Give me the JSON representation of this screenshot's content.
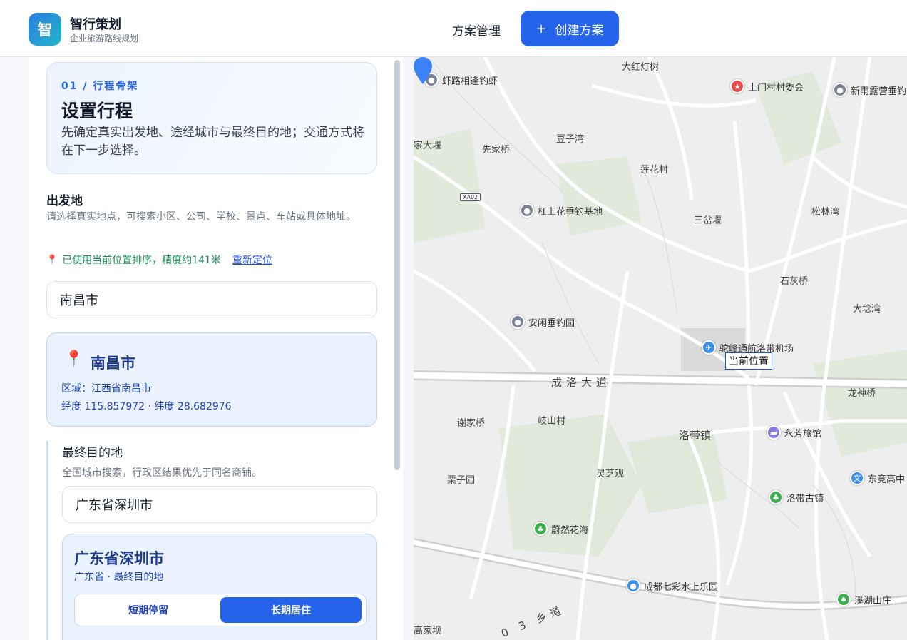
{
  "header": {
    "logo_char": "智",
    "app_name": "智行策划",
    "app_subtitle": "企业旅游路线规划",
    "nav_manage": "方案管理",
    "create_plus": "+",
    "create_label": "创建方案",
    "brand_color": "#2563eb"
  },
  "itinerary": {
    "step": "01 / 行程骨架",
    "title": "设置行程",
    "description": "先确定真实出发地、途经城市与最终目的地；交通方式将在下一步选择。"
  },
  "departure": {
    "title": "出发地",
    "description": "请选择真实地点，可搜索小区、公司、学校、景点、车站或具体地址。",
    "location_status": "已使用当前位置排序，精度约141米",
    "relocate_label": "重新定位",
    "input_value": "南昌市",
    "card": {
      "name": "南昌市",
      "region": "区域：江西省南昌市",
      "coords": "经度 115.857972 · 纬度 28.682976"
    }
  },
  "destination": {
    "title": "最终目的地",
    "description": "全国城市搜索，行政区结果优先于同名商铺。",
    "input_value": "广东省深圳市",
    "card": {
      "name": "广东省深圳市",
      "sub": "广东省 · 最终目的地",
      "option_short": "短期停留",
      "option_long": "长期居住",
      "selected": "长期居住"
    }
  },
  "map": {
    "current_position": "当前位置",
    "road_shield": "XA02",
    "roads": {
      "chengluo": "成洛大道",
      "xiang": "0 3 乡道"
    },
    "pois": [
      {
        "name": "虾路相逢钓虾",
        "icon": "poi-icon"
      },
      {
        "name": "土门村村委会",
        "icon": "government-icon"
      },
      {
        "name": "新雨露营垂钓",
        "icon": "poi-icon"
      },
      {
        "name": "杠上花垂钓基地",
        "icon": "poi-icon"
      },
      {
        "name": "安闲垂钓园",
        "icon": "poi-icon"
      },
      {
        "name": "驼峰通航洛带机场",
        "icon": "airport-icon"
      },
      {
        "name": "永芳旅馆",
        "icon": "hotel-icon"
      },
      {
        "name": "东竞高中",
        "icon": "school-icon"
      },
      {
        "name": "洛带古镇",
        "icon": "scenic-icon"
      },
      {
        "name": "蔚然花海",
        "icon": "scenic-icon"
      },
      {
        "name": "成都七彩水上乐园",
        "icon": "park-icon"
      },
      {
        "name": "溪湖山庄",
        "icon": "resort-icon"
      }
    ],
    "places": {
      "dahongdengshu": "大红灯树",
      "doizi": "豆子湾",
      "jiadayan": "家大堰",
      "xianjiaqiao": "先家桥",
      "lianhuacun": "莲花村",
      "sanchayan": "三岔堰",
      "songlinwan": "松林湾",
      "shihuiqiao": "石灰桥",
      "dalunwan": "大埝湾",
      "longshenqiao": "龙神桥",
      "xiejiaqiao": "谢家桥",
      "qishancun": "岐山村",
      "luodaizhen": "洛带镇",
      "liziyuan": "栗子园",
      "lingzhiguan": "灵芝观",
      "gaojiaken": "高家坝"
    }
  }
}
